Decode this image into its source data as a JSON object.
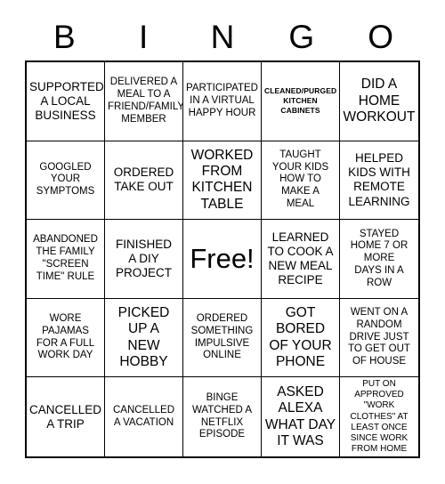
{
  "header": {
    "letters": [
      "B",
      "I",
      "N",
      "G",
      "O"
    ]
  },
  "grid": {
    "rows": 5,
    "columns": 5,
    "cells": [
      {
        "text": "SUPPORTED\nA LOCAL\nBUSINESS",
        "size": "fs-l"
      },
      {
        "text": "DELIVERED A\nMEAL TO A\nFRIEND/FAMILY\nMEMBER",
        "size": "fs-m"
      },
      {
        "text": "PARTICIPATED\nIN A VIRTUAL\nHAPPY HOUR",
        "size": "fs-m"
      },
      {
        "text": "CLEANED/PURGED\nKITCHEN\nCABINETS",
        "size": "fs-xs"
      },
      {
        "text": "DID A\nHOME\nWORKOUT",
        "size": "fs-xl"
      },
      {
        "text": "GOOGLED\nYOUR\nSYMPTOMS",
        "size": "fs-m"
      },
      {
        "text": "ORDERED\nTAKE OUT",
        "size": "fs-l"
      },
      {
        "text": "WORKED\nFROM\nKITCHEN\nTABLE",
        "size": "fs-xl"
      },
      {
        "text": "TAUGHT\nYOUR KIDS\nHOW TO\nMAKE A\nMEAL",
        "size": "fs-m"
      },
      {
        "text": "HELPED\nKIDS WITH\nREMOTE\nLEARNING",
        "size": "fs-l"
      },
      {
        "text": "ABANDONED\nTHE FAMILY\n\"SCREEN\nTIME\" RULE",
        "size": "fs-m"
      },
      {
        "text": "FINISHED\nA DIY\nPROJECT",
        "size": "fs-l"
      },
      {
        "text": "Free!",
        "size": "fs-free"
      },
      {
        "text": "LEARNED\nTO COOK A\nNEW MEAL\nRECIPE",
        "size": "fs-l"
      },
      {
        "text": "STAYED\nHOME 7 OR\nMORE\nDAYS IN A\nROW",
        "size": "fs-m"
      },
      {
        "text": "WORE\nPAJAMAS\nFOR A FULL\nWORK DAY",
        "size": "fs-m"
      },
      {
        "text": "PICKED\nUP A\nNEW\nHOBBY",
        "size": "fs-xl"
      },
      {
        "text": "ORDERED\nSOMETHING\nIMPULSIVE\nONLINE",
        "size": "fs-m"
      },
      {
        "text": "GOT\nBORED\nOF YOUR\nPHONE",
        "size": "fs-xl"
      },
      {
        "text": "WENT ON A\nRANDOM\nDRIVE JUST\nTO GET OUT\nOF HOUSE",
        "size": "fs-m"
      },
      {
        "text": "CANCELLED\nA TRIP",
        "size": "fs-l"
      },
      {
        "text": "CANCELLED\nA VACATION",
        "size": "fs-m"
      },
      {
        "text": "BINGE\nWATCHED A\nNETFLIX\nEPISODE",
        "size": "fs-m"
      },
      {
        "text": "ASKED\nALEXA\nWHAT DAY\nIT WAS",
        "size": "fs-xl"
      },
      {
        "text": "PUT ON\nAPPROVED\n\"WORK\nCLOTHES\" AT\nLEAST ONCE\nSINCE WORK\nFROM HOME",
        "size": "fs-s"
      }
    ]
  },
  "colors": {
    "background": "#ffffff",
    "text": "#000000",
    "border": "#000000"
  }
}
